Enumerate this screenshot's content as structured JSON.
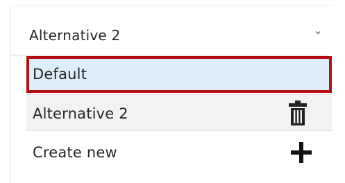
{
  "dropdown": {
    "selected_value": "Alternative 2",
    "chevron_icon": "chevron-down-icon",
    "options": [
      {
        "label": "Default",
        "state": "hovered-highlighted"
      },
      {
        "label": "Alternative 2",
        "action_icon": "trash-icon"
      },
      {
        "label": "Create new",
        "action_icon": "plus-icon"
      }
    ]
  },
  "colors": {
    "highlight_border": "#b50e14",
    "highlight_fill": "#dceef9",
    "row_fill": "#f2f2f2",
    "text": "#262626"
  }
}
